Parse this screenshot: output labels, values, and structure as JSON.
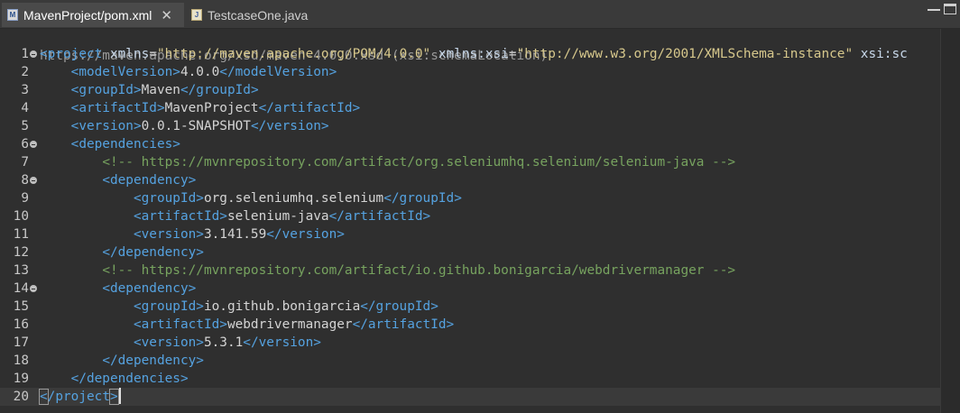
{
  "tabs": [
    {
      "label": "MavenProject/pom.xml",
      "close": "✕",
      "icon": "xml-file-icon",
      "active": true
    },
    {
      "label": "TestcaseOne.java",
      "icon": "java-file-icon",
      "active": false
    }
  ],
  "editor": {
    "schema_hint": "https://maven.apache.org/xsd/maven-4.0.0.xsd (xsi:schemaLocation)",
    "lines": [
      {
        "n": "1",
        "fold": true,
        "parts": [
          {
            "c": "tag",
            "t": "<project "
          },
          {
            "c": "attr",
            "t": "xmlns"
          },
          {
            "c": "val",
            "t": "="
          },
          {
            "c": "str",
            "t": "\"http://maven.apache.org/POM/4.0.0\""
          },
          {
            "c": "val",
            "t": " "
          },
          {
            "c": "attr",
            "t": "xmlns:xsi"
          },
          {
            "c": "val",
            "t": "="
          },
          {
            "c": "str",
            "t": "\"http://www.w3.org/2001/XMLSchema-instance\""
          },
          {
            "c": "val",
            "t": " "
          },
          {
            "c": "attr",
            "t": "xsi:sc"
          }
        ]
      },
      {
        "n": "2",
        "parts": [
          {
            "c": "txt",
            "t": "    "
          },
          {
            "c": "tag",
            "t": "<modelVersion>"
          },
          {
            "c": "txt",
            "t": "4.0.0"
          },
          {
            "c": "tag",
            "t": "</modelVersion>"
          }
        ]
      },
      {
        "n": "3",
        "parts": [
          {
            "c": "txt",
            "t": "    "
          },
          {
            "c": "tag",
            "t": "<groupId>"
          },
          {
            "c": "txt",
            "t": "Maven"
          },
          {
            "c": "tag",
            "t": "</groupId>"
          }
        ]
      },
      {
        "n": "4",
        "parts": [
          {
            "c": "txt",
            "t": "    "
          },
          {
            "c": "tag",
            "t": "<artifactId>"
          },
          {
            "c": "txt",
            "t": "MavenProject"
          },
          {
            "c": "tag",
            "t": "</artifactId>"
          }
        ]
      },
      {
        "n": "5",
        "parts": [
          {
            "c": "txt",
            "t": "    "
          },
          {
            "c": "tag",
            "t": "<version>"
          },
          {
            "c": "txt",
            "t": "0.0.1-SNAPSHOT"
          },
          {
            "c": "tag",
            "t": "</version>"
          }
        ]
      },
      {
        "n": "6",
        "fold": true,
        "parts": [
          {
            "c": "txt",
            "t": "    "
          },
          {
            "c": "tag",
            "t": "<dependencies>"
          }
        ]
      },
      {
        "n": "7",
        "parts": [
          {
            "c": "txt",
            "t": "        "
          },
          {
            "c": "cmt",
            "t": "<!-- https://mvnrepository.com/artifact/org.seleniumhq.selenium/selenium-java -->"
          }
        ]
      },
      {
        "n": "8",
        "fold": true,
        "parts": [
          {
            "c": "txt",
            "t": "        "
          },
          {
            "c": "tag",
            "t": "<dependency>"
          }
        ]
      },
      {
        "n": "9",
        "parts": [
          {
            "c": "txt",
            "t": "            "
          },
          {
            "c": "tag",
            "t": "<groupId>"
          },
          {
            "c": "txt",
            "t": "org.seleniumhq.selenium"
          },
          {
            "c": "tag",
            "t": "</groupId>"
          }
        ]
      },
      {
        "n": "10",
        "parts": [
          {
            "c": "txt",
            "t": "            "
          },
          {
            "c": "tag",
            "t": "<artifactId>"
          },
          {
            "c": "txt",
            "t": "selenium-java"
          },
          {
            "c": "tag",
            "t": "</artifactId>"
          }
        ]
      },
      {
        "n": "11",
        "parts": [
          {
            "c": "txt",
            "t": "            "
          },
          {
            "c": "tag",
            "t": "<version>"
          },
          {
            "c": "txt",
            "t": "3.141.59"
          },
          {
            "c": "tag",
            "t": "</version>"
          }
        ]
      },
      {
        "n": "12",
        "parts": [
          {
            "c": "txt",
            "t": "        "
          },
          {
            "c": "tag",
            "t": "</dependency>"
          }
        ]
      },
      {
        "n": "13",
        "parts": [
          {
            "c": "txt",
            "t": "        "
          },
          {
            "c": "cmt",
            "t": "<!-- https://mvnrepository.com/artifact/io.github.bonigarcia/webdrivermanager -->"
          }
        ]
      },
      {
        "n": "14",
        "fold": true,
        "parts": [
          {
            "c": "txt",
            "t": "        "
          },
          {
            "c": "tag",
            "t": "<dependency>"
          }
        ]
      },
      {
        "n": "15",
        "parts": [
          {
            "c": "txt",
            "t": "            "
          },
          {
            "c": "tag",
            "t": "<groupId>"
          },
          {
            "c": "txt",
            "t": "io.github.bonigarcia"
          },
          {
            "c": "tag",
            "t": "</groupId>"
          }
        ]
      },
      {
        "n": "16",
        "parts": [
          {
            "c": "txt",
            "t": "            "
          },
          {
            "c": "tag",
            "t": "<artifactId>"
          },
          {
            "c": "txt",
            "t": "webdrivermanager"
          },
          {
            "c": "tag",
            "t": "</artifactId>"
          }
        ]
      },
      {
        "n": "17",
        "parts": [
          {
            "c": "txt",
            "t": "            "
          },
          {
            "c": "tag",
            "t": "<version>"
          },
          {
            "c": "txt",
            "t": "5.3.1"
          },
          {
            "c": "tag",
            "t": "</version>"
          }
        ]
      },
      {
        "n": "18",
        "parts": [
          {
            "c": "txt",
            "t": "        "
          },
          {
            "c": "tag",
            "t": "</dependency>"
          }
        ]
      },
      {
        "n": "19",
        "parts": [
          {
            "c": "txt",
            "t": "    "
          },
          {
            "c": "tag",
            "t": "</dependencies>"
          }
        ]
      },
      {
        "n": "20",
        "current": true,
        "caret": true,
        "parts": [
          {
            "c": "tag bracket-box",
            "t": "<"
          },
          {
            "c": "tag",
            "t": "/project"
          },
          {
            "c": "tag bracket-box",
            "t": ">"
          }
        ]
      }
    ]
  },
  "colors": {
    "background": "#2f2f2f",
    "tag": "#55a2e0",
    "string": "#d7c88c",
    "comment": "#77a35f",
    "text": "#d4d4d4"
  }
}
